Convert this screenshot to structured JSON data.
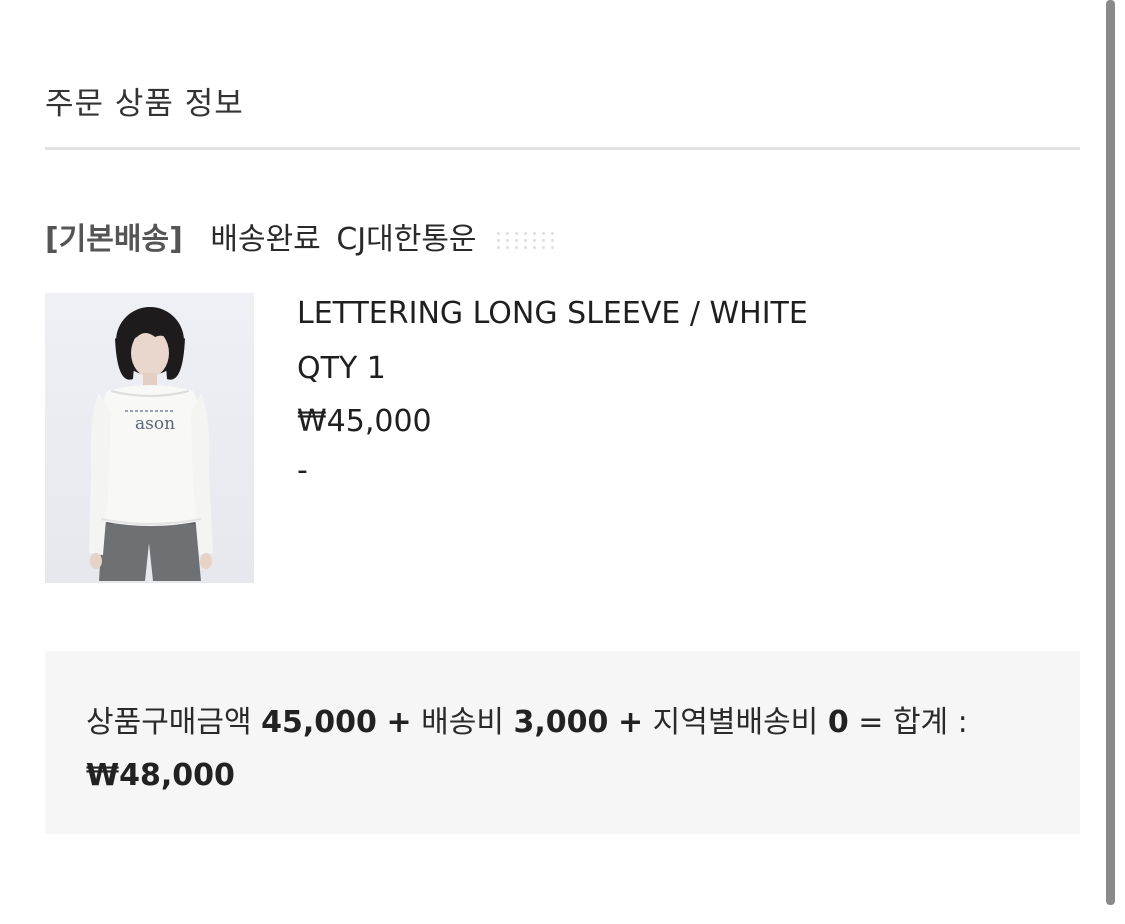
{
  "section": {
    "title": "주문 상품 정보"
  },
  "shipping": {
    "type": "[기본배송]",
    "status": "배송완료",
    "carrier": "CJ대한통운"
  },
  "product": {
    "name": "LETTERING LONG SLEEVE / WHITE",
    "qty": "QTY 1",
    "price": "₩45,000",
    "option": "-",
    "image_text": "ason"
  },
  "summary": {
    "product_label": "상품구매금액",
    "product_amount": "45,000",
    "plus1": "+",
    "shipping_label": "배송비",
    "shipping_amount": "3,000",
    "plus2": "+",
    "regional_label": "지역별배송비",
    "regional_amount": "0",
    "equals": "=",
    "total_label": "합계 :",
    "total_amount": "₩48,000"
  }
}
